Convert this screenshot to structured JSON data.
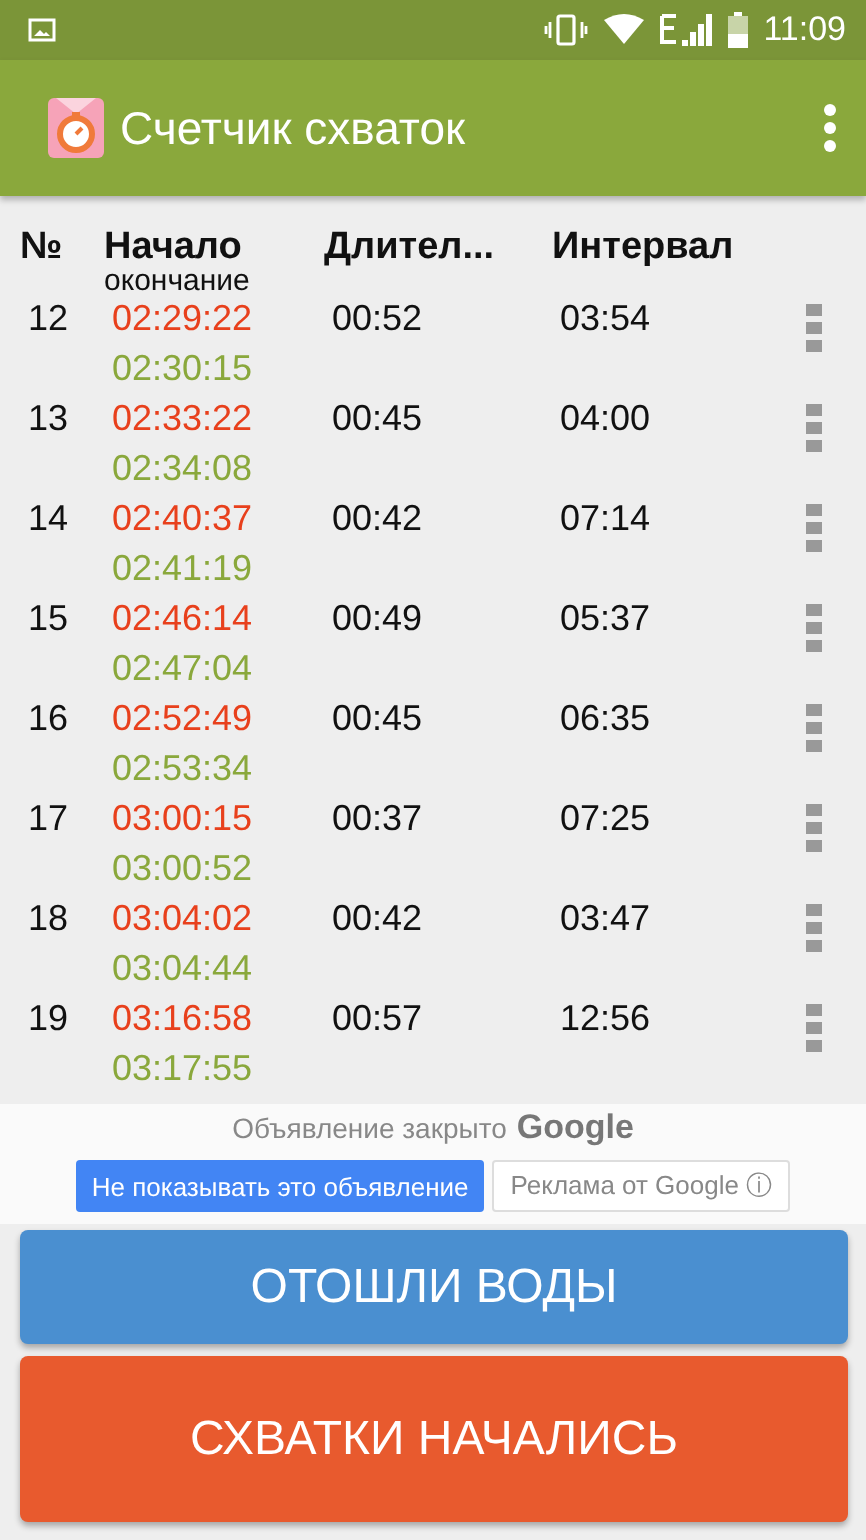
{
  "status_bar": {
    "time": "11:09"
  },
  "app_bar": {
    "title": "Счетчик схваток"
  },
  "table": {
    "columns": [
      {
        "label": "№"
      },
      {
        "label": "Начало",
        "sublabel": "окончание"
      },
      {
        "label": "Длител..."
      },
      {
        "label": "Интервал"
      }
    ],
    "rows": [
      {
        "number": "12",
        "start": "02:29:22",
        "end": "02:30:15",
        "duration": "00:52",
        "interval": "03:54"
      },
      {
        "number": "13",
        "start": "02:33:22",
        "end": "02:34:08",
        "duration": "00:45",
        "interval": "04:00"
      },
      {
        "number": "14",
        "start": "02:40:37",
        "end": "02:41:19",
        "duration": "00:42",
        "interval": "07:14"
      },
      {
        "number": "15",
        "start": "02:46:14",
        "end": "02:47:04",
        "duration": "00:49",
        "interval": "05:37"
      },
      {
        "number": "16",
        "start": "02:52:49",
        "end": "02:53:34",
        "duration": "00:45",
        "interval": "06:35"
      },
      {
        "number": "17",
        "start": "03:00:15",
        "end": "03:00:52",
        "duration": "00:37",
        "interval": "07:25"
      },
      {
        "number": "18",
        "start": "03:04:02",
        "end": "03:04:44",
        "duration": "00:42",
        "interval": "03:47"
      },
      {
        "number": "19",
        "start": "03:16:58",
        "end": "03:17:55",
        "duration": "00:57",
        "interval": "12:56"
      }
    ]
  },
  "ad": {
    "notice": "Объявление закрыто",
    "brand": "Google",
    "buttons": [
      {
        "label": "Не показывать это объявление",
        "kind": "primary"
      },
      {
        "label": "Реклама от Google",
        "kind": "info",
        "icon": "ⓘ"
      }
    ]
  },
  "buttons": [
    {
      "label": "ОТОШЛИ ВОДЫ",
      "color": "#4a8fd0"
    },
    {
      "label": "СХВАТКИ НАЧАЛИСЬ",
      "color": "#e85a2e"
    }
  ]
}
